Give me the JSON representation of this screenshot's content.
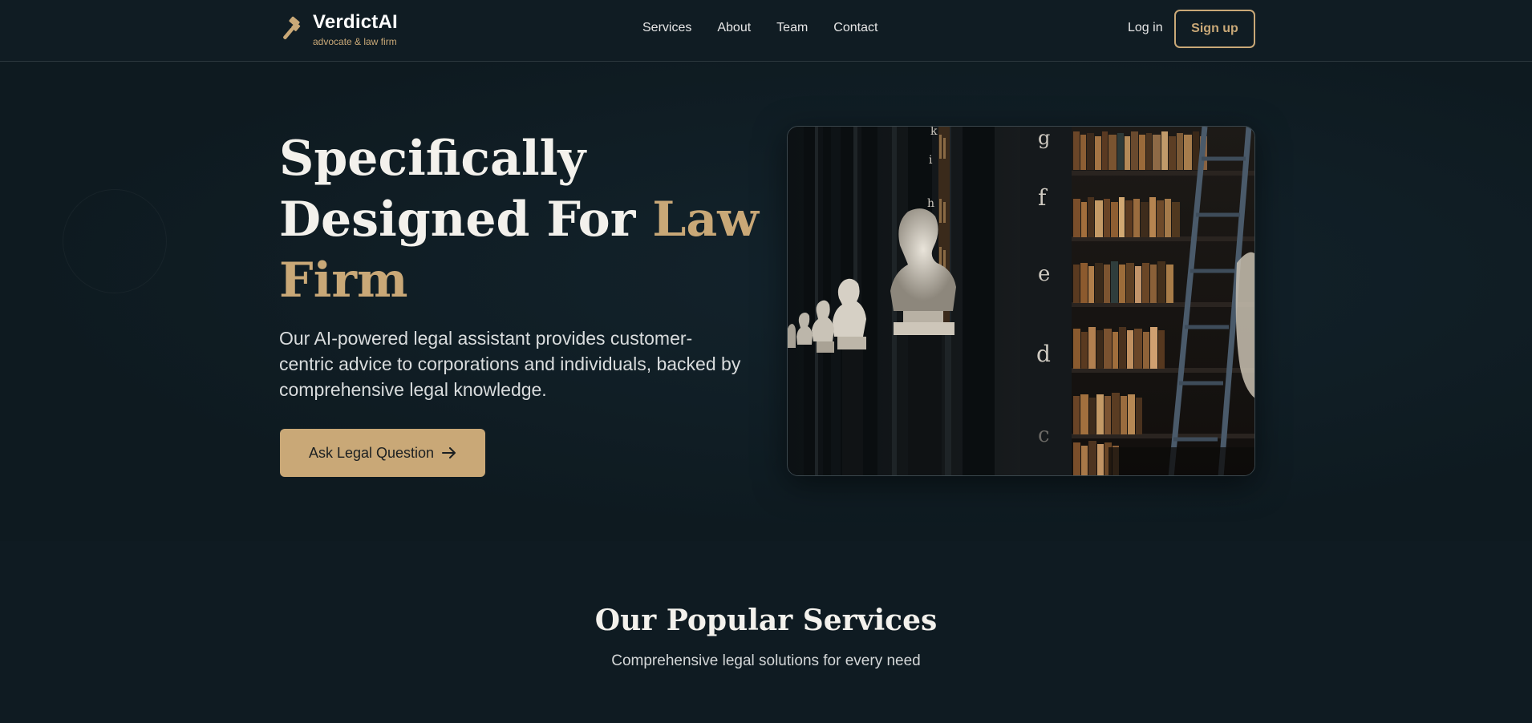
{
  "brand": {
    "name": "VerdictAI",
    "tagline": "advocate & law firm",
    "icon": "gavel-icon",
    "accent_color": "#c9a877"
  },
  "nav": {
    "items": [
      "Services",
      "About",
      "Team",
      "Contact"
    ],
    "login_label": "Log in",
    "signup_label": "Sign up"
  },
  "hero": {
    "title_line1": "Specifically",
    "title_line2_plain": "Designed For",
    "title_accent": "Law Firm",
    "description": "Our AI-powered legal assistant provides customer-centric advice to corporations and individuals, backed by comprehensive legal knowledge.",
    "cta_label": "Ask Legal Question",
    "cta_icon": "arrow-right-icon",
    "image_letters": [
      "k",
      "i",
      "h",
      "g",
      "f",
      "e",
      "d",
      "c"
    ]
  },
  "services": {
    "title": "Our Popular Services",
    "subtitle": "Comprehensive legal solutions for every need"
  }
}
